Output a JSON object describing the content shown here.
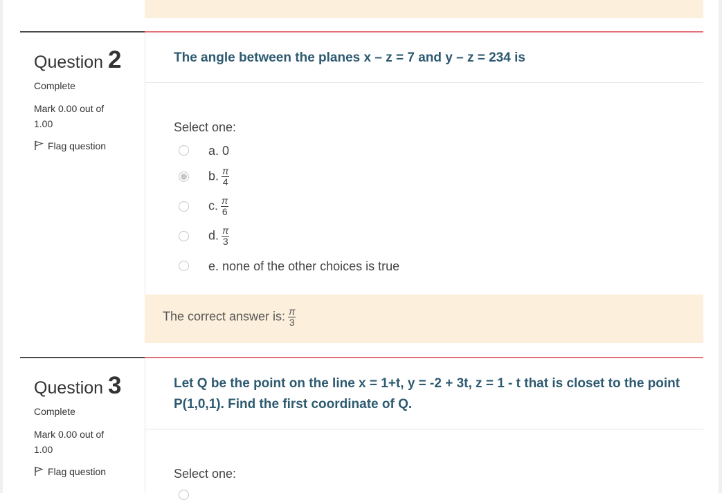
{
  "questions": [
    {
      "title_word": "Question",
      "number": "2",
      "state": "Complete",
      "mark": "Mark 0.00 out of 1.00",
      "flag_label": "Flag question",
      "text": "The angle between the planes x – z = 7 and y – z = 234 is",
      "prompt": "Select one:",
      "options": [
        {
          "letter": "a.",
          "text": "0",
          "selected": false
        },
        {
          "letter": "b.",
          "num": "π",
          "den": "4",
          "selected": true
        },
        {
          "letter": "c.",
          "num": "π",
          "den": "6",
          "selected": false
        },
        {
          "letter": "d.",
          "num": "π",
          "den": "3",
          "selected": false
        },
        {
          "letter": "e.",
          "text": "none of the other choices is true",
          "selected": false
        }
      ],
      "feedback_label": "The correct answer is:",
      "feedback_num": "π",
      "feedback_den": "3"
    },
    {
      "title_word": "Question",
      "number": "3",
      "state": "Complete",
      "mark": "Mark 0.00 out of 1.00",
      "flag_label": "Flag question",
      "text": "Let Q be the point on the line x = 1+t, y = -2 + 3t, z = 1 - t that is closet to the point P(1,0,1). Find the first coordinate of Q.",
      "prompt": "Select one:"
    }
  ],
  "colors": {
    "question_text": "#2d5a70",
    "feedback_bg": "#fcefdc",
    "accent_line": "#e4717a"
  }
}
